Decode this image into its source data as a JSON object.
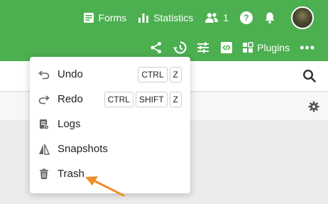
{
  "header": {
    "forms_label": "Forms",
    "statistics_label": "Statistics",
    "users_count": "1",
    "help_glyph": "?",
    "plugins_label": "Plugins",
    "more_glyph": "•••",
    "brand_color": "#4caf50"
  },
  "menu": {
    "items": [
      {
        "label": "Undo",
        "icon": "undo-icon",
        "keys": [
          "CTRL",
          "Z"
        ]
      },
      {
        "label": "Redo",
        "icon": "redo-icon",
        "keys": [
          "CTRL",
          "SHIFT",
          "Z"
        ]
      },
      {
        "label": "Logs",
        "icon": "logs-icon",
        "keys": []
      },
      {
        "label": "Snapshots",
        "icon": "snapshots-icon",
        "keys": []
      },
      {
        "label": "Trash",
        "icon": "trash-icon",
        "keys": []
      }
    ]
  },
  "annotation": {
    "arrow_color": "#f28c28",
    "points_to": "Trash"
  }
}
